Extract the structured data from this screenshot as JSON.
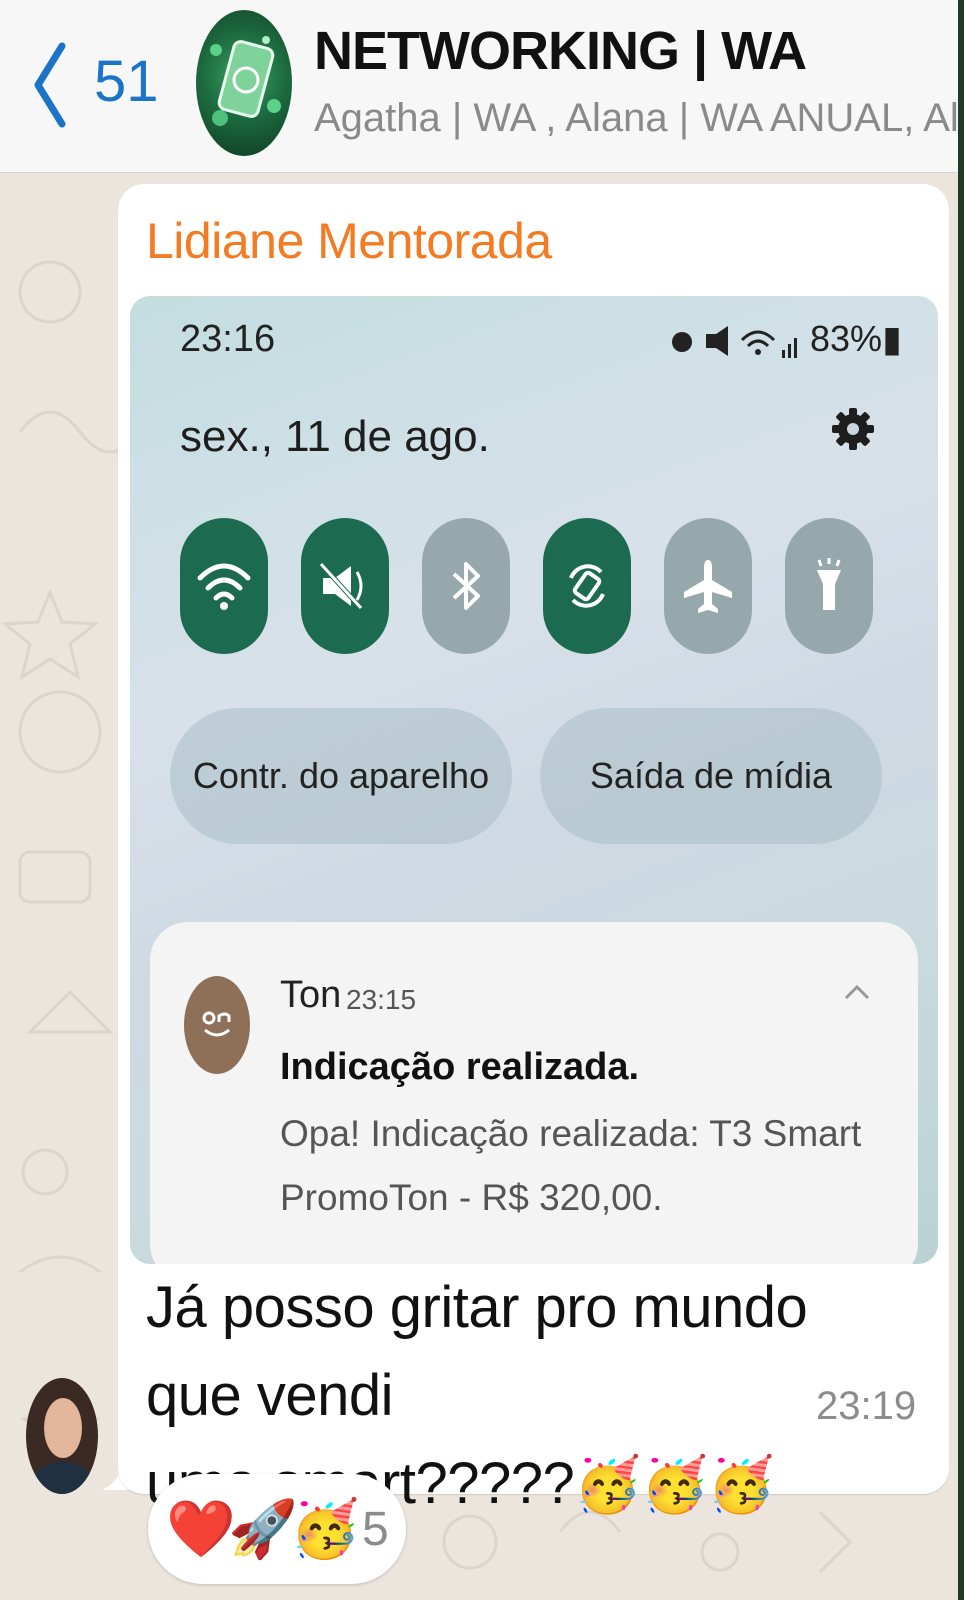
{
  "header": {
    "back_icon": "chevron-left-icon",
    "unread_count": "51",
    "title": "NETWORKING | WA",
    "subtitle": "Agatha | WA , Alana | WA ANUAL, Aline..."
  },
  "message": {
    "sender": "Lidiane Mentorada",
    "sender_color": "#f47b22",
    "text_line1": "Já posso gritar pro mundo que vendi",
    "text_line2": "uma smart?????",
    "text_emojis": "🥳🥳🥳",
    "time": "23:19",
    "reactions": {
      "emoji1": "❤️",
      "emoji2": "🚀",
      "emoji3": "🥳",
      "count": "5"
    }
  },
  "screenshot": {
    "status_time": "23:16",
    "battery": "83%",
    "date": "sex., 11 de ago.",
    "quick_settings": [
      {
        "name": "wifi-icon",
        "state": "on"
      },
      {
        "name": "mute-icon",
        "state": "on"
      },
      {
        "name": "bluetooth-icon",
        "state": "off"
      },
      {
        "name": "auto-rotate-icon",
        "state": "on"
      },
      {
        "name": "airplane-icon",
        "state": "off"
      },
      {
        "name": "flashlight-icon",
        "state": "off"
      }
    ],
    "pill_left": "Contr. do aparelho",
    "pill_right": "Saída de mídia",
    "notification": {
      "app": "Ton",
      "time": "23:15",
      "title": "Indicação realizada.",
      "body": "Opa! Indicação realizada: T3 Smart PromoTon - R$ 320,00."
    }
  },
  "colors": {
    "accent_blue": "#1b74c7",
    "qs_on": "#1c6b51",
    "qs_off": "#97a8ad",
    "wallpaper": "#ece5dd"
  }
}
